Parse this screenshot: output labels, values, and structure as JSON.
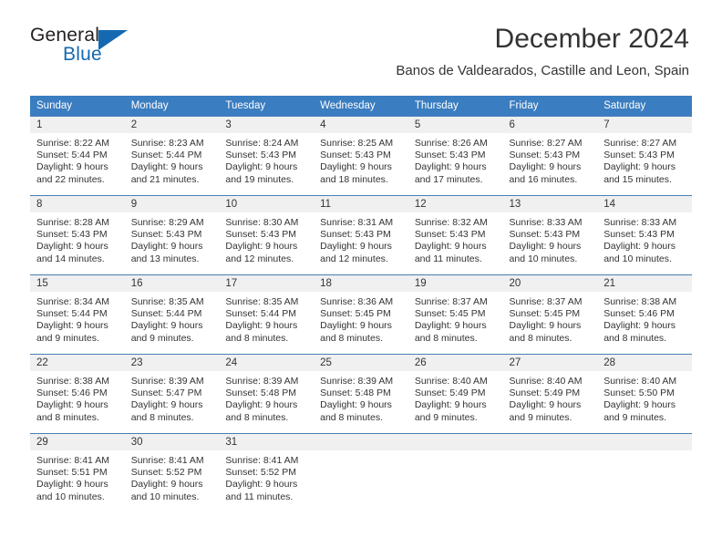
{
  "brand": {
    "line1": "General",
    "line2": "Blue",
    "triangle_color": "#1569b0"
  },
  "header": {
    "month_title": "December 2024",
    "location": "Banos de Valdearados, Castille and Leon, Spain"
  },
  "colors": {
    "header_row_background": "#3a7dc0",
    "header_row_text": "#ffffff",
    "daynum_background": "#f0f0f0",
    "cell_border": "#4a7fb5",
    "body_text": "#333333"
  },
  "weekday_headers": [
    "Sunday",
    "Monday",
    "Tuesday",
    "Wednesday",
    "Thursday",
    "Friday",
    "Saturday"
  ],
  "weeks": [
    [
      {
        "day": "1",
        "sunrise": "Sunrise: 8:22 AM",
        "sunset": "Sunset: 5:44 PM",
        "daylight1": "Daylight: 9 hours",
        "daylight2": "and 22 minutes."
      },
      {
        "day": "2",
        "sunrise": "Sunrise: 8:23 AM",
        "sunset": "Sunset: 5:44 PM",
        "daylight1": "Daylight: 9 hours",
        "daylight2": "and 21 minutes."
      },
      {
        "day": "3",
        "sunrise": "Sunrise: 8:24 AM",
        "sunset": "Sunset: 5:43 PM",
        "daylight1": "Daylight: 9 hours",
        "daylight2": "and 19 minutes."
      },
      {
        "day": "4",
        "sunrise": "Sunrise: 8:25 AM",
        "sunset": "Sunset: 5:43 PM",
        "daylight1": "Daylight: 9 hours",
        "daylight2": "and 18 minutes."
      },
      {
        "day": "5",
        "sunrise": "Sunrise: 8:26 AM",
        "sunset": "Sunset: 5:43 PM",
        "daylight1": "Daylight: 9 hours",
        "daylight2": "and 17 minutes."
      },
      {
        "day": "6",
        "sunrise": "Sunrise: 8:27 AM",
        "sunset": "Sunset: 5:43 PM",
        "daylight1": "Daylight: 9 hours",
        "daylight2": "and 16 minutes."
      },
      {
        "day": "7",
        "sunrise": "Sunrise: 8:27 AM",
        "sunset": "Sunset: 5:43 PM",
        "daylight1": "Daylight: 9 hours",
        "daylight2": "and 15 minutes."
      }
    ],
    [
      {
        "day": "8",
        "sunrise": "Sunrise: 8:28 AM",
        "sunset": "Sunset: 5:43 PM",
        "daylight1": "Daylight: 9 hours",
        "daylight2": "and 14 minutes."
      },
      {
        "day": "9",
        "sunrise": "Sunrise: 8:29 AM",
        "sunset": "Sunset: 5:43 PM",
        "daylight1": "Daylight: 9 hours",
        "daylight2": "and 13 minutes."
      },
      {
        "day": "10",
        "sunrise": "Sunrise: 8:30 AM",
        "sunset": "Sunset: 5:43 PM",
        "daylight1": "Daylight: 9 hours",
        "daylight2": "and 12 minutes."
      },
      {
        "day": "11",
        "sunrise": "Sunrise: 8:31 AM",
        "sunset": "Sunset: 5:43 PM",
        "daylight1": "Daylight: 9 hours",
        "daylight2": "and 12 minutes."
      },
      {
        "day": "12",
        "sunrise": "Sunrise: 8:32 AM",
        "sunset": "Sunset: 5:43 PM",
        "daylight1": "Daylight: 9 hours",
        "daylight2": "and 11 minutes."
      },
      {
        "day": "13",
        "sunrise": "Sunrise: 8:33 AM",
        "sunset": "Sunset: 5:43 PM",
        "daylight1": "Daylight: 9 hours",
        "daylight2": "and 10 minutes."
      },
      {
        "day": "14",
        "sunrise": "Sunrise: 8:33 AM",
        "sunset": "Sunset: 5:43 PM",
        "daylight1": "Daylight: 9 hours",
        "daylight2": "and 10 minutes."
      }
    ],
    [
      {
        "day": "15",
        "sunrise": "Sunrise: 8:34 AM",
        "sunset": "Sunset: 5:44 PM",
        "daylight1": "Daylight: 9 hours",
        "daylight2": "and 9 minutes."
      },
      {
        "day": "16",
        "sunrise": "Sunrise: 8:35 AM",
        "sunset": "Sunset: 5:44 PM",
        "daylight1": "Daylight: 9 hours",
        "daylight2": "and 9 minutes."
      },
      {
        "day": "17",
        "sunrise": "Sunrise: 8:35 AM",
        "sunset": "Sunset: 5:44 PM",
        "daylight1": "Daylight: 9 hours",
        "daylight2": "and 8 minutes."
      },
      {
        "day": "18",
        "sunrise": "Sunrise: 8:36 AM",
        "sunset": "Sunset: 5:45 PM",
        "daylight1": "Daylight: 9 hours",
        "daylight2": "and 8 minutes."
      },
      {
        "day": "19",
        "sunrise": "Sunrise: 8:37 AM",
        "sunset": "Sunset: 5:45 PM",
        "daylight1": "Daylight: 9 hours",
        "daylight2": "and 8 minutes."
      },
      {
        "day": "20",
        "sunrise": "Sunrise: 8:37 AM",
        "sunset": "Sunset: 5:45 PM",
        "daylight1": "Daylight: 9 hours",
        "daylight2": "and 8 minutes."
      },
      {
        "day": "21",
        "sunrise": "Sunrise: 8:38 AM",
        "sunset": "Sunset: 5:46 PM",
        "daylight1": "Daylight: 9 hours",
        "daylight2": "and 8 minutes."
      }
    ],
    [
      {
        "day": "22",
        "sunrise": "Sunrise: 8:38 AM",
        "sunset": "Sunset: 5:46 PM",
        "daylight1": "Daylight: 9 hours",
        "daylight2": "and 8 minutes."
      },
      {
        "day": "23",
        "sunrise": "Sunrise: 8:39 AM",
        "sunset": "Sunset: 5:47 PM",
        "daylight1": "Daylight: 9 hours",
        "daylight2": "and 8 minutes."
      },
      {
        "day": "24",
        "sunrise": "Sunrise: 8:39 AM",
        "sunset": "Sunset: 5:48 PM",
        "daylight1": "Daylight: 9 hours",
        "daylight2": "and 8 minutes."
      },
      {
        "day": "25",
        "sunrise": "Sunrise: 8:39 AM",
        "sunset": "Sunset: 5:48 PM",
        "daylight1": "Daylight: 9 hours",
        "daylight2": "and 8 minutes."
      },
      {
        "day": "26",
        "sunrise": "Sunrise: 8:40 AM",
        "sunset": "Sunset: 5:49 PM",
        "daylight1": "Daylight: 9 hours",
        "daylight2": "and 9 minutes."
      },
      {
        "day": "27",
        "sunrise": "Sunrise: 8:40 AM",
        "sunset": "Sunset: 5:49 PM",
        "daylight1": "Daylight: 9 hours",
        "daylight2": "and 9 minutes."
      },
      {
        "day": "28",
        "sunrise": "Sunrise: 8:40 AM",
        "sunset": "Sunset: 5:50 PM",
        "daylight1": "Daylight: 9 hours",
        "daylight2": "and 9 minutes."
      }
    ],
    [
      {
        "day": "29",
        "sunrise": "Sunrise: 8:41 AM",
        "sunset": "Sunset: 5:51 PM",
        "daylight1": "Daylight: 9 hours",
        "daylight2": "and 10 minutes."
      },
      {
        "day": "30",
        "sunrise": "Sunrise: 8:41 AM",
        "sunset": "Sunset: 5:52 PM",
        "daylight1": "Daylight: 9 hours",
        "daylight2": "and 10 minutes."
      },
      {
        "day": "31",
        "sunrise": "Sunrise: 8:41 AM",
        "sunset": "Sunset: 5:52 PM",
        "daylight1": "Daylight: 9 hours",
        "daylight2": "and 11 minutes."
      },
      {
        "day": "",
        "sunrise": "",
        "sunset": "",
        "daylight1": "",
        "daylight2": ""
      },
      {
        "day": "",
        "sunrise": "",
        "sunset": "",
        "daylight1": "",
        "daylight2": ""
      },
      {
        "day": "",
        "sunrise": "",
        "sunset": "",
        "daylight1": "",
        "daylight2": ""
      },
      {
        "day": "",
        "sunrise": "",
        "sunset": "",
        "daylight1": "",
        "daylight2": ""
      }
    ]
  ]
}
